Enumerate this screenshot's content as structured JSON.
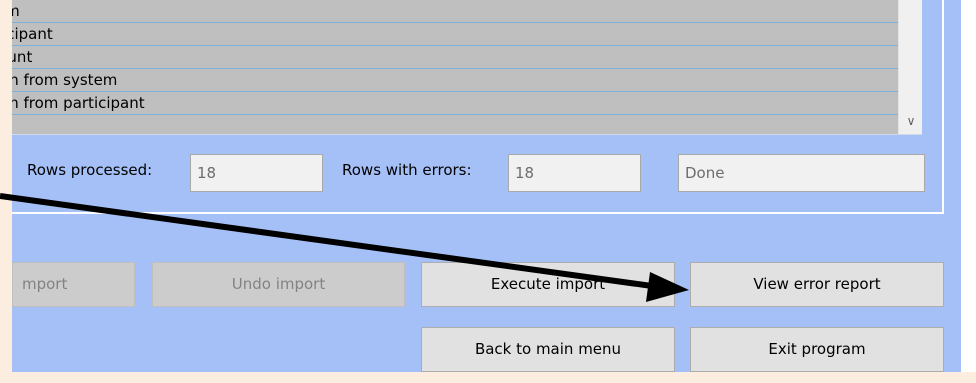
{
  "list": {
    "rows": [
      "tem",
      "rticipant",
      "count",
      "tion from system",
      "tion from participant"
    ]
  },
  "stats": {
    "rows_processed_label": "Rows processed:",
    "rows_processed_value": "18",
    "rows_with_errors_label": "Rows with errors:",
    "rows_with_errors_value": "18",
    "status_value": "Done"
  },
  "buttons": {
    "import_label": "mport",
    "undo_import_label": "Undo import",
    "execute_import_label": "Execute import",
    "view_error_report_label": "View error report",
    "back_to_main_menu_label": "Back to main menu",
    "exit_program_label": "Exit program"
  },
  "icons": {
    "scroll_down": "chevron-down-icon"
  },
  "colors": {
    "form_background": "#a5c0f6",
    "list_row": "#bfbfbf",
    "row_separator": "#7fb1d8",
    "annotation_arrow": "#000000"
  }
}
